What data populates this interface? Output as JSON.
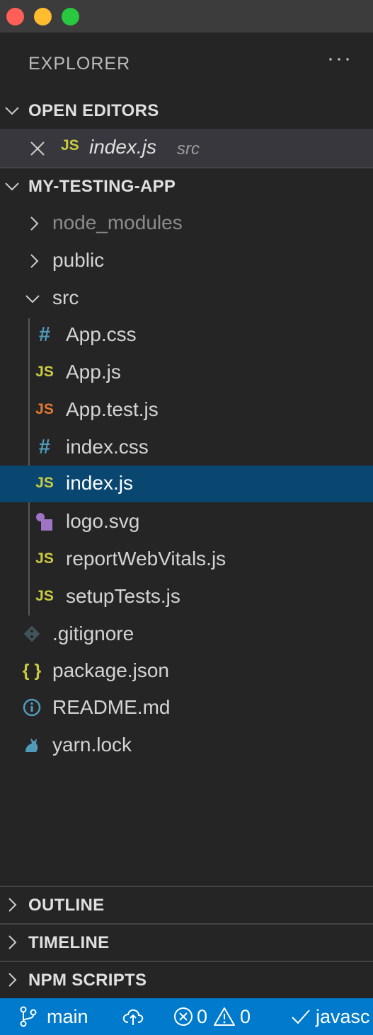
{
  "explorer": {
    "title": "EXPLORER",
    "more": "···"
  },
  "open_editors": {
    "header": "OPEN EDITORS",
    "items": [
      {
        "icon": "JS",
        "name": "index.js",
        "path": "src"
      }
    ]
  },
  "project": {
    "header": "MY-TESTING-APP",
    "items": [
      {
        "name": "node_modules",
        "type": "folder",
        "state": "collapsed",
        "dimmed": true
      },
      {
        "name": "public",
        "type": "folder",
        "state": "collapsed"
      },
      {
        "name": "src",
        "type": "folder",
        "state": "expanded"
      },
      {
        "name": "App.css",
        "icon": "#"
      },
      {
        "name": "App.js",
        "icon": "JS"
      },
      {
        "name": "App.test.js",
        "icon": "JS"
      },
      {
        "name": "index.css",
        "icon": "#"
      },
      {
        "name": "index.js",
        "icon": "JS",
        "selected": true
      },
      {
        "name": "logo.svg",
        "icon": "svg-image-icon"
      },
      {
        "name": "reportWebVitals.js",
        "icon": "JS"
      },
      {
        "name": "setupTests.js",
        "icon": "JS"
      },
      {
        "name": ".gitignore",
        "icon": "git-icon"
      },
      {
        "name": "package.json",
        "icon": "{ }"
      },
      {
        "name": "README.md",
        "icon": "info-icon"
      },
      {
        "name": "yarn.lock",
        "icon": "yarn-cat-icon"
      }
    ]
  },
  "panels": {
    "outline": "OUTLINE",
    "timeline": "TIMELINE",
    "npm_scripts": "NPM SCRIPTS"
  },
  "status_bar": {
    "branch": "main",
    "errors": "0",
    "warnings": "0",
    "language": "javasc"
  },
  "colors": {
    "sidebar_bg": "#252526",
    "titlebar_bg": "#3c3c3c",
    "selection_bg": "#094771",
    "status_bar_bg": "#007acc",
    "js_icon": "#cbcb41",
    "test_js_icon": "#e37933",
    "css_icon": "#519aba",
    "svg_icon": "#a074c4"
  }
}
